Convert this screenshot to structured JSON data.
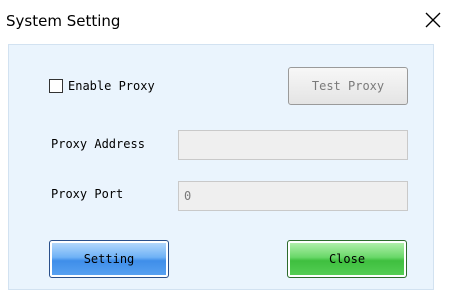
{
  "window": {
    "title": "System Setting",
    "close_icon": "close-x-icon"
  },
  "proxy": {
    "enable_label": "Enable Proxy",
    "enable_checked": false,
    "test_button_label": "Test Proxy",
    "test_button_enabled": false,
    "address_label": "Proxy Address",
    "address_value": "",
    "port_label": "Proxy Port",
    "port_value": "0"
  },
  "footer": {
    "setting_label": "Setting",
    "close_label": "Close"
  },
  "colors": {
    "client_background": "#eaf4fd",
    "setting_button": "#4c9cef",
    "close_button": "#48c848"
  }
}
